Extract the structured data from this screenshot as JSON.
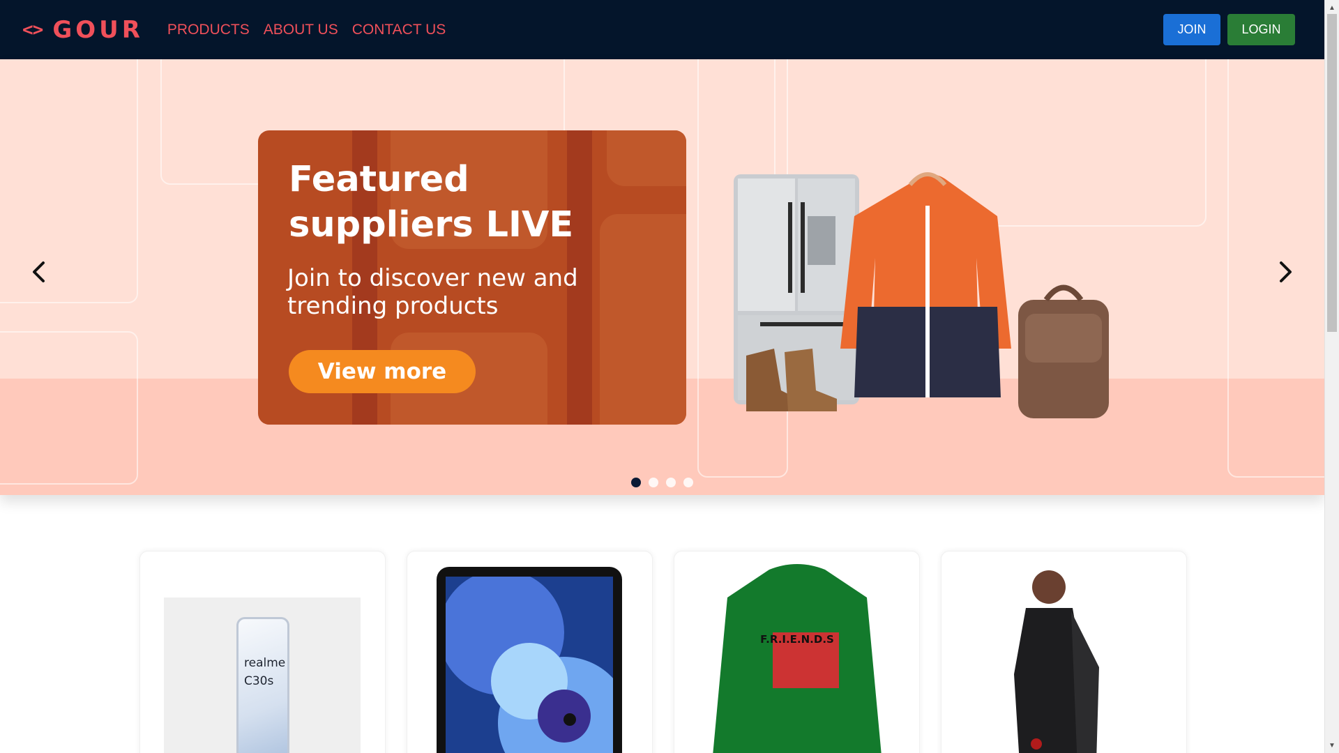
{
  "nav": {
    "logo_icon": "<>",
    "brand": "GOUR",
    "links": [
      "PRODUCTS",
      "ABOUT US",
      "CONTACT US"
    ],
    "join_label": "JOIN",
    "login_label": "LOGIN"
  },
  "carousel": {
    "slide": {
      "title": "Featured suppliers LIVE",
      "subtitle": "Join to discover new and trending products",
      "cta_label": "View more"
    },
    "slide_count": 4,
    "active_index": 0,
    "prev_icon": "chevron-left-icon",
    "next_icon": "chevron-right-icon"
  },
  "products": [
    {
      "name": "realme C30s",
      "image_text": "realme\nC30s"
    },
    {
      "name": "iPad",
      "image_text": ""
    },
    {
      "name": "Friends shirt",
      "image_text": "F.R.I.E.N.D.S"
    },
    {
      "name": "Kurta suit",
      "image_text": ""
    }
  ],
  "colors": {
    "nav_bg": "#04152b",
    "brand": "#f0505a",
    "join": "#1a6fd6",
    "login": "#2a7d36",
    "hero_bg": "#ffe0d6",
    "promo_bg": "#b74b22",
    "cta": "#f58a1f"
  }
}
